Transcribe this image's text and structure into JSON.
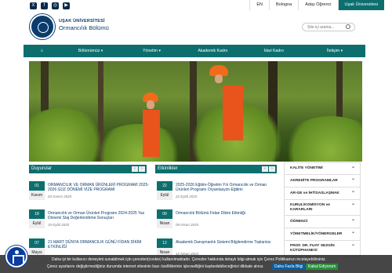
{
  "topbar": {
    "social_icons": [
      "x-icon",
      "facebook-icon",
      "instagram-icon",
      "youtube-icon"
    ],
    "links": [
      "EN",
      "Bologna",
      "Aday Öğrenci",
      "Uşak Üniversitesi"
    ]
  },
  "header": {
    "university": "UŞAK ÜNİVERSİTESİ",
    "department": "Ormancılık Bölümü",
    "search_placeholder": "Site içi arama..."
  },
  "nav": {
    "items": [
      "",
      "Bölümümüz ▾",
      "Yönetim ▾",
      "Akademik Kadro",
      "İdari Kadro",
      "İletişim ▾"
    ]
  },
  "duyurular": {
    "title": "Duyurular",
    "items": [
      {
        "day": "01",
        "month": "Kasım",
        "title": "ORMANCILIK VE ORMAN ÜRÜNLERİ PROGRAMI 2025-2026 GÜZ DÖNEMİ VİZE PROGRAMI",
        "date": "03 Kasım 2025"
      },
      {
        "day": "18",
        "month": "Eylül",
        "title": "Ormancılık ve Orman Ürünleri Programı 2024-2025 Yaz Dönemi Staj Değerlendirme Sonuçları",
        "date": "19 Eylül 2025"
      },
      {
        "day": "07",
        "month": "Mayıs",
        "title": "21 MART DÜNYA ORMANCILIK GÜNÜ FİDAN DİKİM ETKİNLİĞİ",
        "date": ""
      }
    ]
  },
  "etkinlikler": {
    "title": "Etkinlikler",
    "items": [
      {
        "day": "22",
        "month": "Eylül",
        "title": "2025-2026 Eğitim-Öğretim Yılı Ormancılık ve Orman Ürünleri Programı Oryantasyon Eğitimi",
        "date": "22 Eylül 2025"
      },
      {
        "day": "09",
        "month": "Nisan",
        "title": "Ormancılık Bölümü Fidan Dikim Etkinliği",
        "date": "09 Nisan 2025"
      },
      {
        "day": "12",
        "month": "Nisan",
        "title": "Akademik Danışmanlık Sistemi Bilgilendirme Toplantısı",
        "date": "12 Nisan 2023"
      }
    ]
  },
  "sidebar": {
    "items": [
      "KALİTE YÖNETİMİ",
      "AKREDİTE PROGRAMLAR",
      "AR-GE ve İHTİSASLAŞMAK",
      "KURUL/KOMİSYON ve KARARLARI",
      "ÖĞRENCİ",
      "YÖNETMELİK/YÖNERGELER",
      "PROF. DR. FUAT SEZGİN KÜTÜPHANESİ"
    ]
  },
  "cookie": {
    "line1": "Daha iyi bir kullanıcı deneyimi sunabilmek için çerezleri(cookie) kullanılmaktadır. Çerezler hakkında detaylı bilgi almak için Çerez Politikamızı incelayebilirsiniz.",
    "line2": "Çerez ayarlarını değiştirmediğiniz durumda internet sitesinin bazı özelliklerinin işlevselliğini kaybedebileceğinizi dikkate alınız.",
    "more_label": "Daha Fazla Bilgi",
    "accept_label": "Kabul Ediyorum"
  },
  "colors": {
    "accent": "#0d6e6e",
    "brand": "#0b3c6e"
  }
}
